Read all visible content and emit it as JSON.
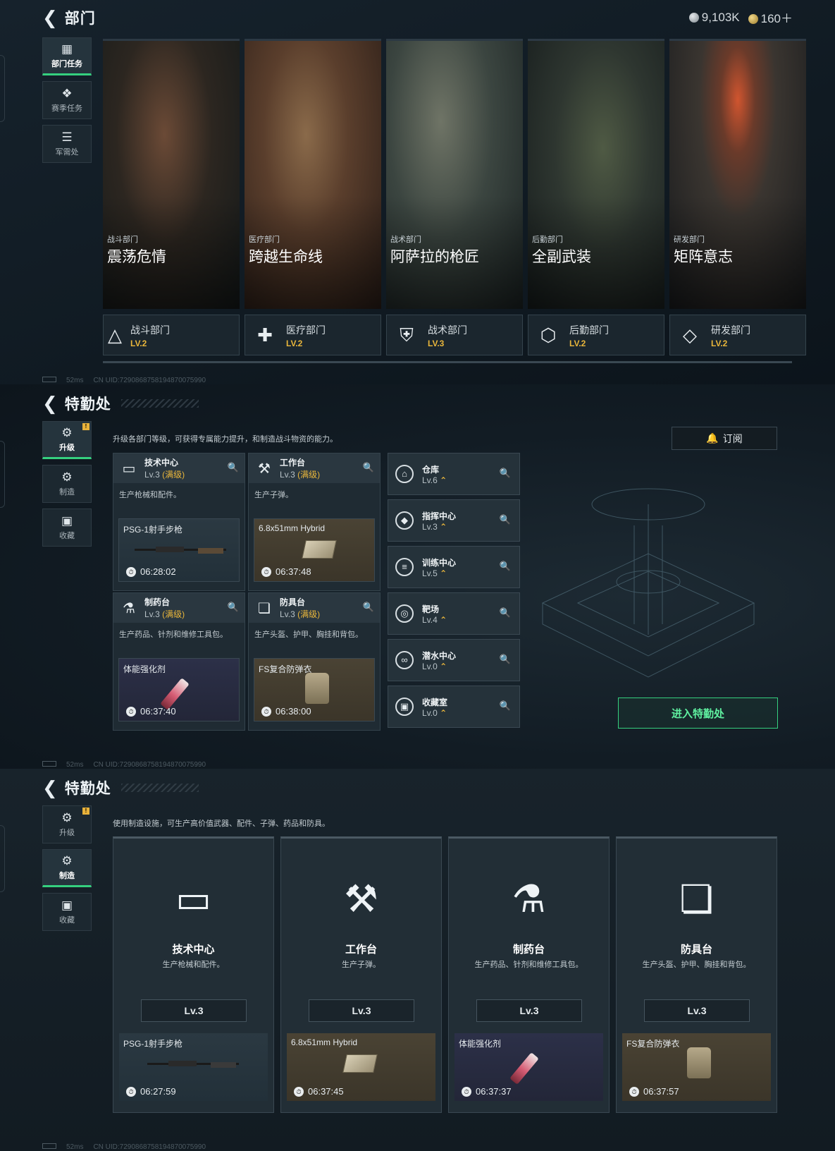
{
  "currency": {
    "silver": "9,103K",
    "gold": "160＋"
  },
  "panel1": {
    "title": "部门",
    "nav": [
      {
        "label": "部门任务",
        "icon": "task-icon",
        "active": true
      },
      {
        "label": "赛季任务",
        "icon": "season-icon",
        "active": false
      },
      {
        "label": "军需处",
        "icon": "supply-icon",
        "active": false
      }
    ],
    "cards": [
      {
        "sub": "战斗部门",
        "title": "震荡危情"
      },
      {
        "sub": "医疗部门",
        "title": "跨越生命线"
      },
      {
        "sub": "战术部门",
        "title": "阿萨拉的枪匠"
      },
      {
        "sub": "后勤部门",
        "title": "全副武装"
      },
      {
        "sub": "研发部门",
        "title": "矩阵意志"
      }
    ],
    "tabs": [
      {
        "name": "战斗部门",
        "lv": "LV.2"
      },
      {
        "name": "医疗部门",
        "lv": "LV.2"
      },
      {
        "name": "战术部门",
        "lv": "LV.3"
      },
      {
        "name": "后勤部门",
        "lv": "LV.2"
      },
      {
        "name": "研发部门",
        "lv": "LV.2"
      }
    ],
    "footer": {
      "ping": "52ms",
      "uid": "CN UID:7290868758194870075990"
    }
  },
  "panel2": {
    "title": "特勤处",
    "nav": [
      {
        "label": "升级",
        "active": true
      },
      {
        "label": "制造",
        "active": false
      },
      {
        "label": "收藏",
        "active": false
      }
    ],
    "badge": "!",
    "desc": "升级各部门等级，可获得专属能力提升，和制造战斗物资的能力。",
    "subscribe": "订阅",
    "facilities": [
      {
        "name": "技术中心",
        "lv": "Lv.3",
        "max": "(满级)",
        "desc": "生产枪械和配件。",
        "product": "PSG-1射手步枪",
        "time": "06:28:02"
      },
      {
        "name": "工作台",
        "lv": "Lv.3",
        "max": "(满级)",
        "desc": "生产子弹。",
        "product": "6.8x51mm Hybrid",
        "time": "06:37:48"
      },
      {
        "name": "制药台",
        "lv": "Lv.3",
        "max": "(满级)",
        "desc": "生产药品、针剂和维修工具包。",
        "product": "体能强化剂",
        "time": "06:37:40"
      },
      {
        "name": "防具台",
        "lv": "Lv.3",
        "max": "(满级)",
        "desc": "生产头盔、护甲、胸挂和背包。",
        "product": "FS复合防弹衣",
        "time": "06:38:00"
      }
    ],
    "rooms": [
      {
        "name": "仓库",
        "lv": "Lv.6"
      },
      {
        "name": "指挥中心",
        "lv": "Lv.3"
      },
      {
        "name": "训练中心",
        "lv": "Lv.5"
      },
      {
        "name": "靶场",
        "lv": "Lv.4"
      },
      {
        "name": "潜水中心",
        "lv": "Lv.0"
      },
      {
        "name": "收藏室",
        "lv": "Lv.0"
      }
    ],
    "enter": "进入特勤处",
    "footer": {
      "ping": "52ms",
      "uid": "CN UID:7290868758194870075990"
    }
  },
  "panel3": {
    "title": "特勤处",
    "nav": [
      {
        "label": "升级",
        "active": false
      },
      {
        "label": "制造",
        "active": true
      },
      {
        "label": "收藏",
        "active": false
      }
    ],
    "badge": "!",
    "desc": "使用制造设施，可生产高价值武器、配件、子弹、药品和防具。",
    "cards": [
      {
        "name": "技术中心",
        "desc": "生产枪械和配件。",
        "lv": "Lv.3",
        "product": "PSG-1射手步枪",
        "time": "06:27:59"
      },
      {
        "name": "工作台",
        "desc": "生产子弹。",
        "lv": "Lv.3",
        "product": "6.8x51mm Hybrid",
        "time": "06:37:45"
      },
      {
        "name": "制药台",
        "desc": "生产药品、针剂和维修工具包。",
        "lv": "Lv.3",
        "product": "体能强化剂",
        "time": "06:37:37"
      },
      {
        "name": "防具台",
        "desc": "生产头盔、护甲、胸挂和背包。",
        "lv": "Lv.3",
        "product": "FS复合防弹衣",
        "time": "06:37:57"
      }
    ],
    "footer": {
      "ping": "52ms",
      "uid": "CN UID:7290868758194870075990"
    }
  },
  "colors": {
    "accent_gold": "#e9b63b",
    "accent_green": "#35d07f",
    "text": "#dfe6ea"
  }
}
